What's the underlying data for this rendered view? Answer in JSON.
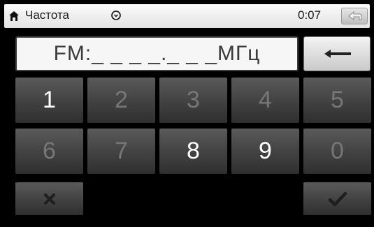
{
  "status_bar": {
    "title": "Частота",
    "time": "0:07"
  },
  "display": {
    "text": "FM:_ _ _ _._ _ _МГц"
  },
  "keypad": {
    "keys": [
      {
        "label": "1",
        "state": "enabled"
      },
      {
        "label": "2",
        "state": "disabled"
      },
      {
        "label": "3",
        "state": "disabled"
      },
      {
        "label": "4",
        "state": "disabled"
      },
      {
        "label": "5",
        "state": "disabled"
      },
      {
        "label": "6",
        "state": "disabled"
      },
      {
        "label": "7",
        "state": "disabled"
      },
      {
        "label": "8",
        "state": "enabled"
      },
      {
        "label": "9",
        "state": "enabled"
      },
      {
        "label": "0",
        "state": "disabled"
      }
    ]
  },
  "icons": {
    "home": "home-icon",
    "clock": "clock-icon",
    "back": "back-arrow-icon",
    "backspace": "backspace-arrow-icon",
    "clear": "x-icon",
    "confirm": "checkmark-icon"
  },
  "colors": {
    "background": "#000000",
    "key_enabled_text": "#ffffff",
    "key_disabled_text": "#888888"
  }
}
